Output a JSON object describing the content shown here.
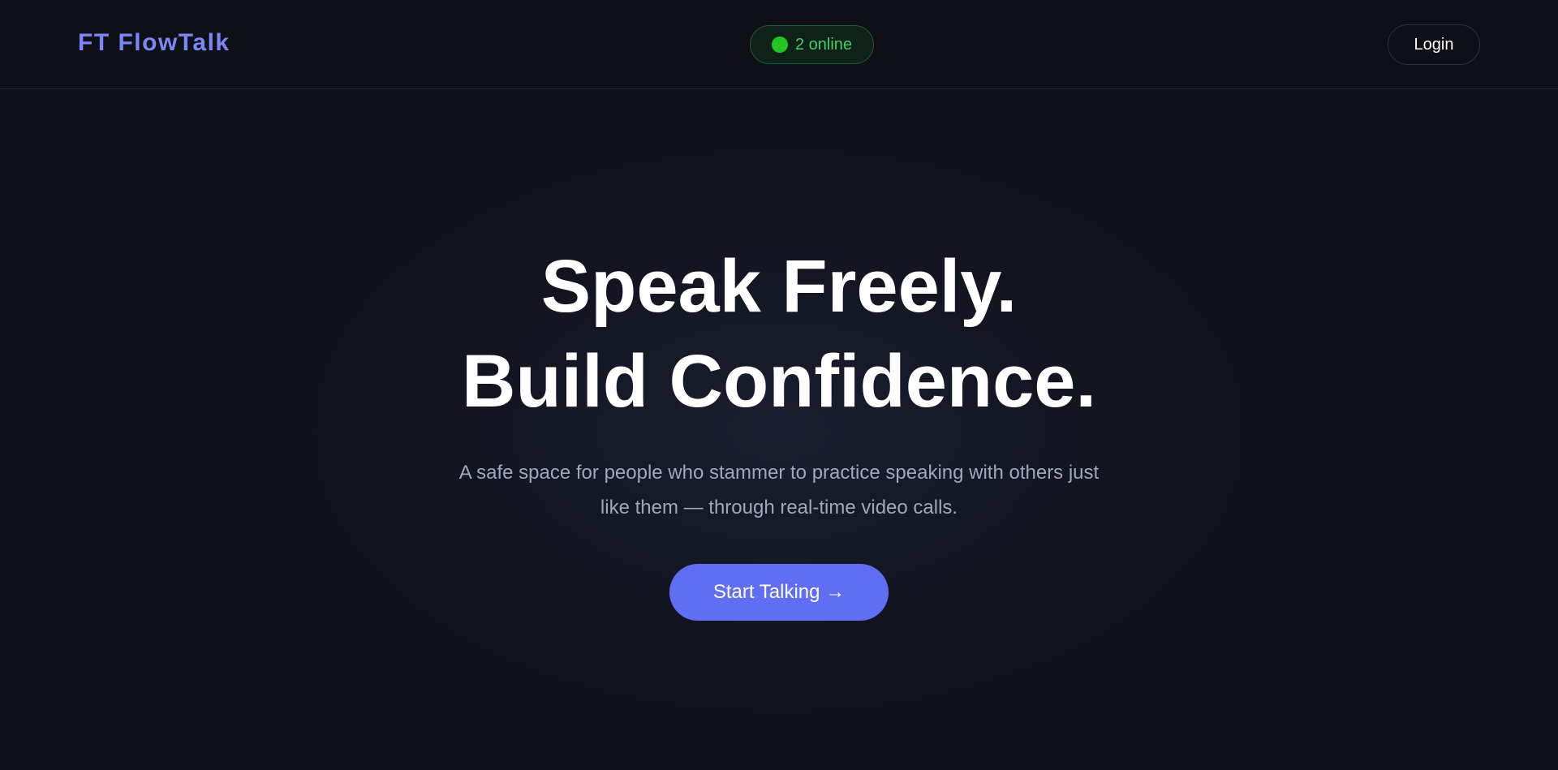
{
  "navbar": {
    "logo": "FT FlowTalk",
    "online_status": "2 online",
    "login_label": "Login"
  },
  "hero": {
    "headline_line1": "Speak Freely.",
    "headline_line2": "Build Confidence.",
    "subtitle": "A safe space for people who stammer to practice speaking with others just like them — through real-time video calls.",
    "cta_label": "Start Talking →"
  },
  "colors": {
    "background": "#0e1016",
    "brand_accent": "#7b86f7",
    "cta_background": "#5f6ef2",
    "online_indicator": "#22c521"
  }
}
